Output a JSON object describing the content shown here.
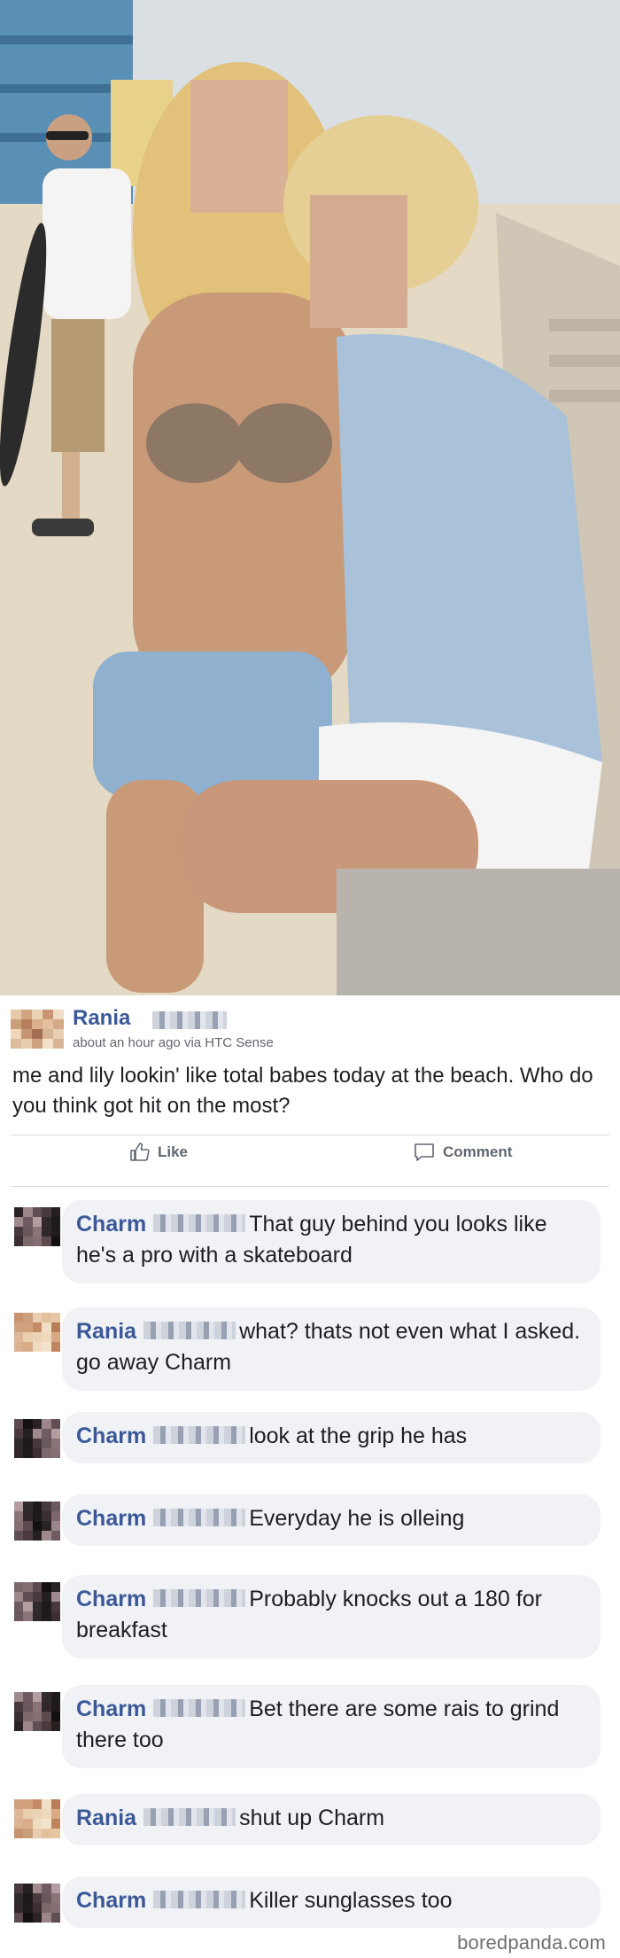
{
  "photo": {
    "description_icon": "beach-photo-two-women"
  },
  "post": {
    "author": "Rania",
    "meta": "about an hour ago via HTC Sense",
    "text": "me and lily lookin' like total babes today at the beach. Who do you think got hit on the most?",
    "actions": {
      "like_label": "Like",
      "comment_label": "Comment"
    }
  },
  "comments": [
    {
      "author": "Charm",
      "text": "That guy behind you looks like he's a pro with a skateboard",
      "avatar": "dark"
    },
    {
      "author": "Rania",
      "text": "what? thats not even what I asked. go away Charm",
      "avatar": "light"
    },
    {
      "author": "Charm",
      "text": "look at the grip he has",
      "avatar": "dark"
    },
    {
      "author": "Charm",
      "text": "Everyday he is olleing",
      "avatar": "dark"
    },
    {
      "author": "Charm",
      "text": "Probably knocks out a 180 for breakfast",
      "avatar": "dark"
    },
    {
      "author": "Charm",
      "text": "Bet there are some rais to grind there too",
      "avatar": "dark"
    },
    {
      "author": "Rania",
      "text": "shut up Charm",
      "avatar": "light"
    },
    {
      "author": "Charm",
      "text": "Killer sunglasses too",
      "avatar": "dark"
    }
  ],
  "watermark": "boredpanda.com",
  "colors": {
    "author_link": "#3b5998",
    "bubble_bg": "#f0f2f5",
    "meta_text": "#616770"
  }
}
